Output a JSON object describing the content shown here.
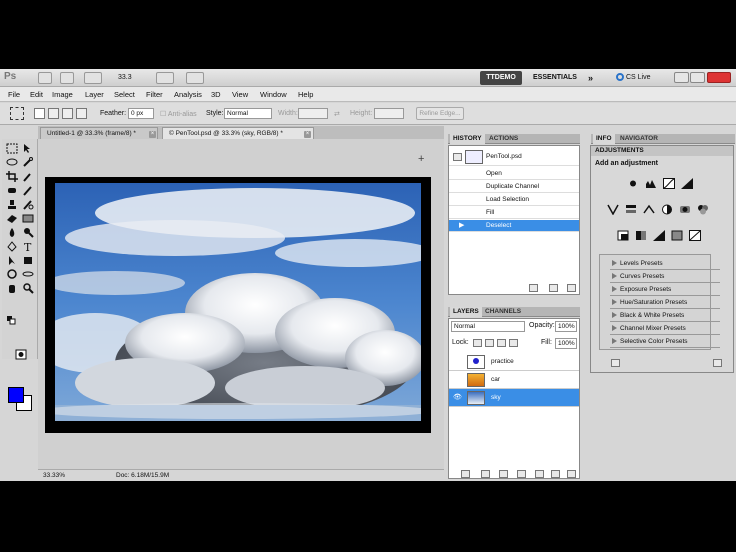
{
  "app": {
    "logo": "Ps",
    "zoom": "33.3",
    "workspace_active": "TTDEMO",
    "workspace_essentials": "ESSENTIALS",
    "more": "»",
    "cs_live": "CS Live"
  },
  "menu": [
    "File",
    "Edit",
    "Image",
    "Layer",
    "Select",
    "Filter",
    "Analysis",
    "3D",
    "View",
    "Window",
    "Help"
  ],
  "options": {
    "feather_label": "Feather:",
    "feather_value": "0 px",
    "antialias_label": "Anti-alias",
    "style_label": "Style:",
    "style_value": "Normal",
    "width_label": "Width:",
    "height_label": "Height:",
    "refine_edge": "Refine Edge..."
  },
  "doc_tabs": [
    {
      "label": "Untitled-1 @ 33.3% (frame/8) *",
      "close": "×"
    },
    {
      "label": "© PenTool.psd @ 33.3% (sky, RGB/8) *",
      "close": "×"
    }
  ],
  "status": {
    "zoom": "33.33%",
    "doc": "Doc: 6.18M/15.9M"
  },
  "history": {
    "tabs": [
      "HISTORY",
      "ACTIONS"
    ],
    "snapshot": "PenTool.psd",
    "items": [
      "Open",
      "Duplicate Channel",
      "Load Selection",
      "Fill",
      "Deselect"
    ]
  },
  "layers": {
    "tabs": [
      "LAYERS",
      "CHANNELS"
    ],
    "blend_mode": "Normal",
    "opacity_label": "Opacity:",
    "opacity_value": "100%",
    "lock_label": "Lock:",
    "fill_label": "Fill:",
    "fill_value": "100%",
    "items": [
      "practice",
      "car",
      "sky"
    ],
    "selected": "sky"
  },
  "right_panel": {
    "tabs": [
      "INFO",
      "NAVIGATOR"
    ],
    "adjustments_title": "ADJUSTMENTS",
    "add_adjustment": "Add an adjustment",
    "presets": [
      "Levels Presets",
      "Curves Presets",
      "Exposure Presets",
      "Hue/Saturation Presets",
      "Black & White Presets",
      "Channel Mixer Presets",
      "Selective Color Presets"
    ]
  },
  "colors": {
    "foreground": "#0000ff",
    "background": "#ffffff",
    "selection": "#3a8ee6"
  }
}
